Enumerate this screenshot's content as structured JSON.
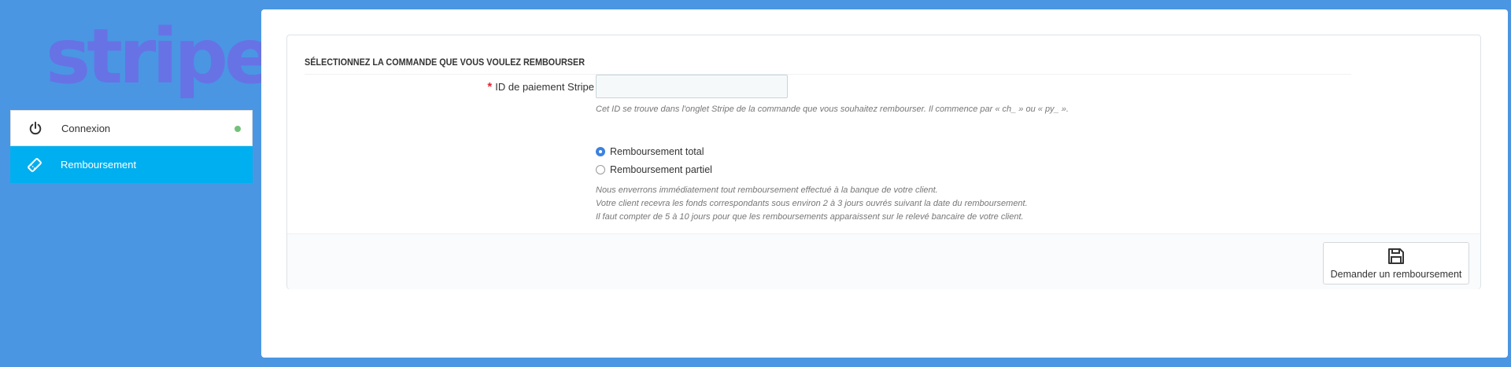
{
  "logo": {
    "text": "stripe",
    "color": "#6772e5"
  },
  "nav": {
    "items": [
      {
        "label": "Connexion",
        "icon": "power-icon",
        "status": "connected",
        "status_color": "#72c279"
      },
      {
        "label": "Remboursement",
        "icon": "ticket-icon",
        "active": true
      }
    ]
  },
  "form": {
    "heading": "Sélectionnez la commande que vous voulez rembourser",
    "payment_id": {
      "required_mark": "*",
      "label": "ID de paiement Stripe",
      "value": "",
      "placeholder": "",
      "help": "Cet ID se trouve dans l'onglet Stripe de la commande que vous souhaitez rembourser. Il commence par « ch_ » ou « py_ »."
    },
    "refund_type": {
      "options": [
        {
          "label": "Remboursement total",
          "checked": true
        },
        {
          "label": "Remboursement partiel",
          "checked": false
        }
      ]
    },
    "notes": [
      "Nous enverrons immédiatement tout remboursement effectué à la banque de votre client.",
      "Votre client recevra les fonds correspondants sous environ 2 à 3 jours ouvrés suivant la date du remboursement.",
      "Il faut compter de 5 à 10 jours pour que les remboursements apparaissent sur le relevé bancaire de votre client."
    ],
    "submit": {
      "label": "Demander un remboursement",
      "icon": "save-icon"
    }
  },
  "colors": {
    "background": "#4a96e3",
    "active_nav": "#00aff0",
    "radio_checked": "#3b82e0"
  }
}
